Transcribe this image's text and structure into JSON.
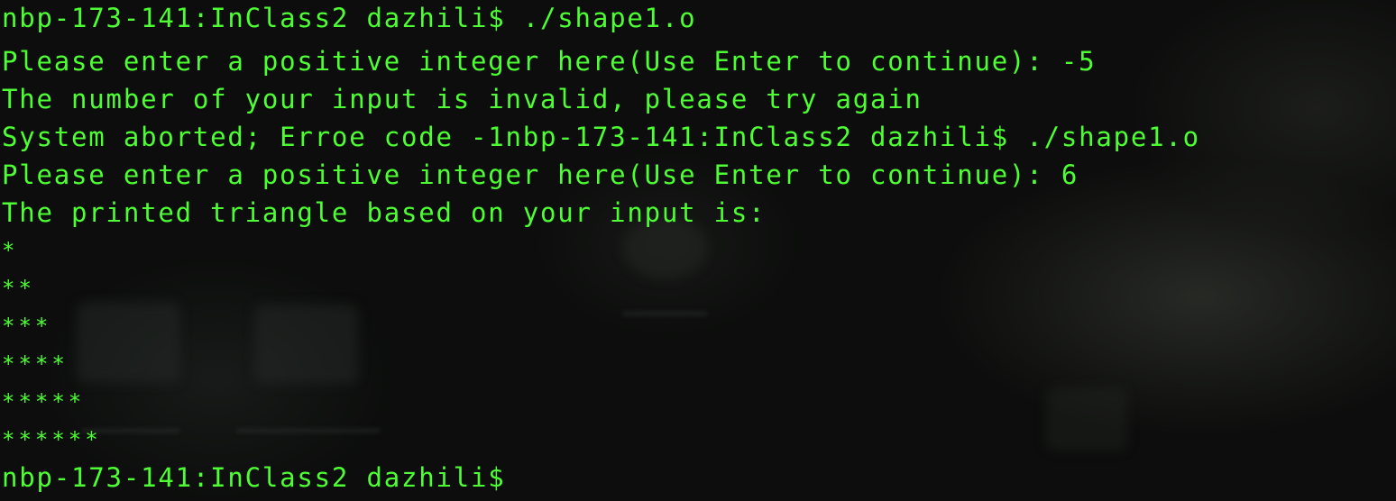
{
  "terminal": {
    "lines": [
      "nbp-173-141:InClass2 dazhili$ ./shape1.o",
      "Please enter a positive integer here(Use Enter to continue): -5",
      "The number of your input is invalid, please try again",
      "System aborted; Erroe code -1nbp-173-141:InClass2 dazhili$ ./shape1.o",
      "Please enter a positive integer here(Use Enter to continue): 6",
      "The printed triangle based on your input is:",
      "*",
      "**",
      "***",
      "****",
      "*****",
      "******",
      "nbp-173-141:InClass2 dazhili$"
    ],
    "text_color": "#4dff32",
    "background_color": "#0c0d0c"
  }
}
